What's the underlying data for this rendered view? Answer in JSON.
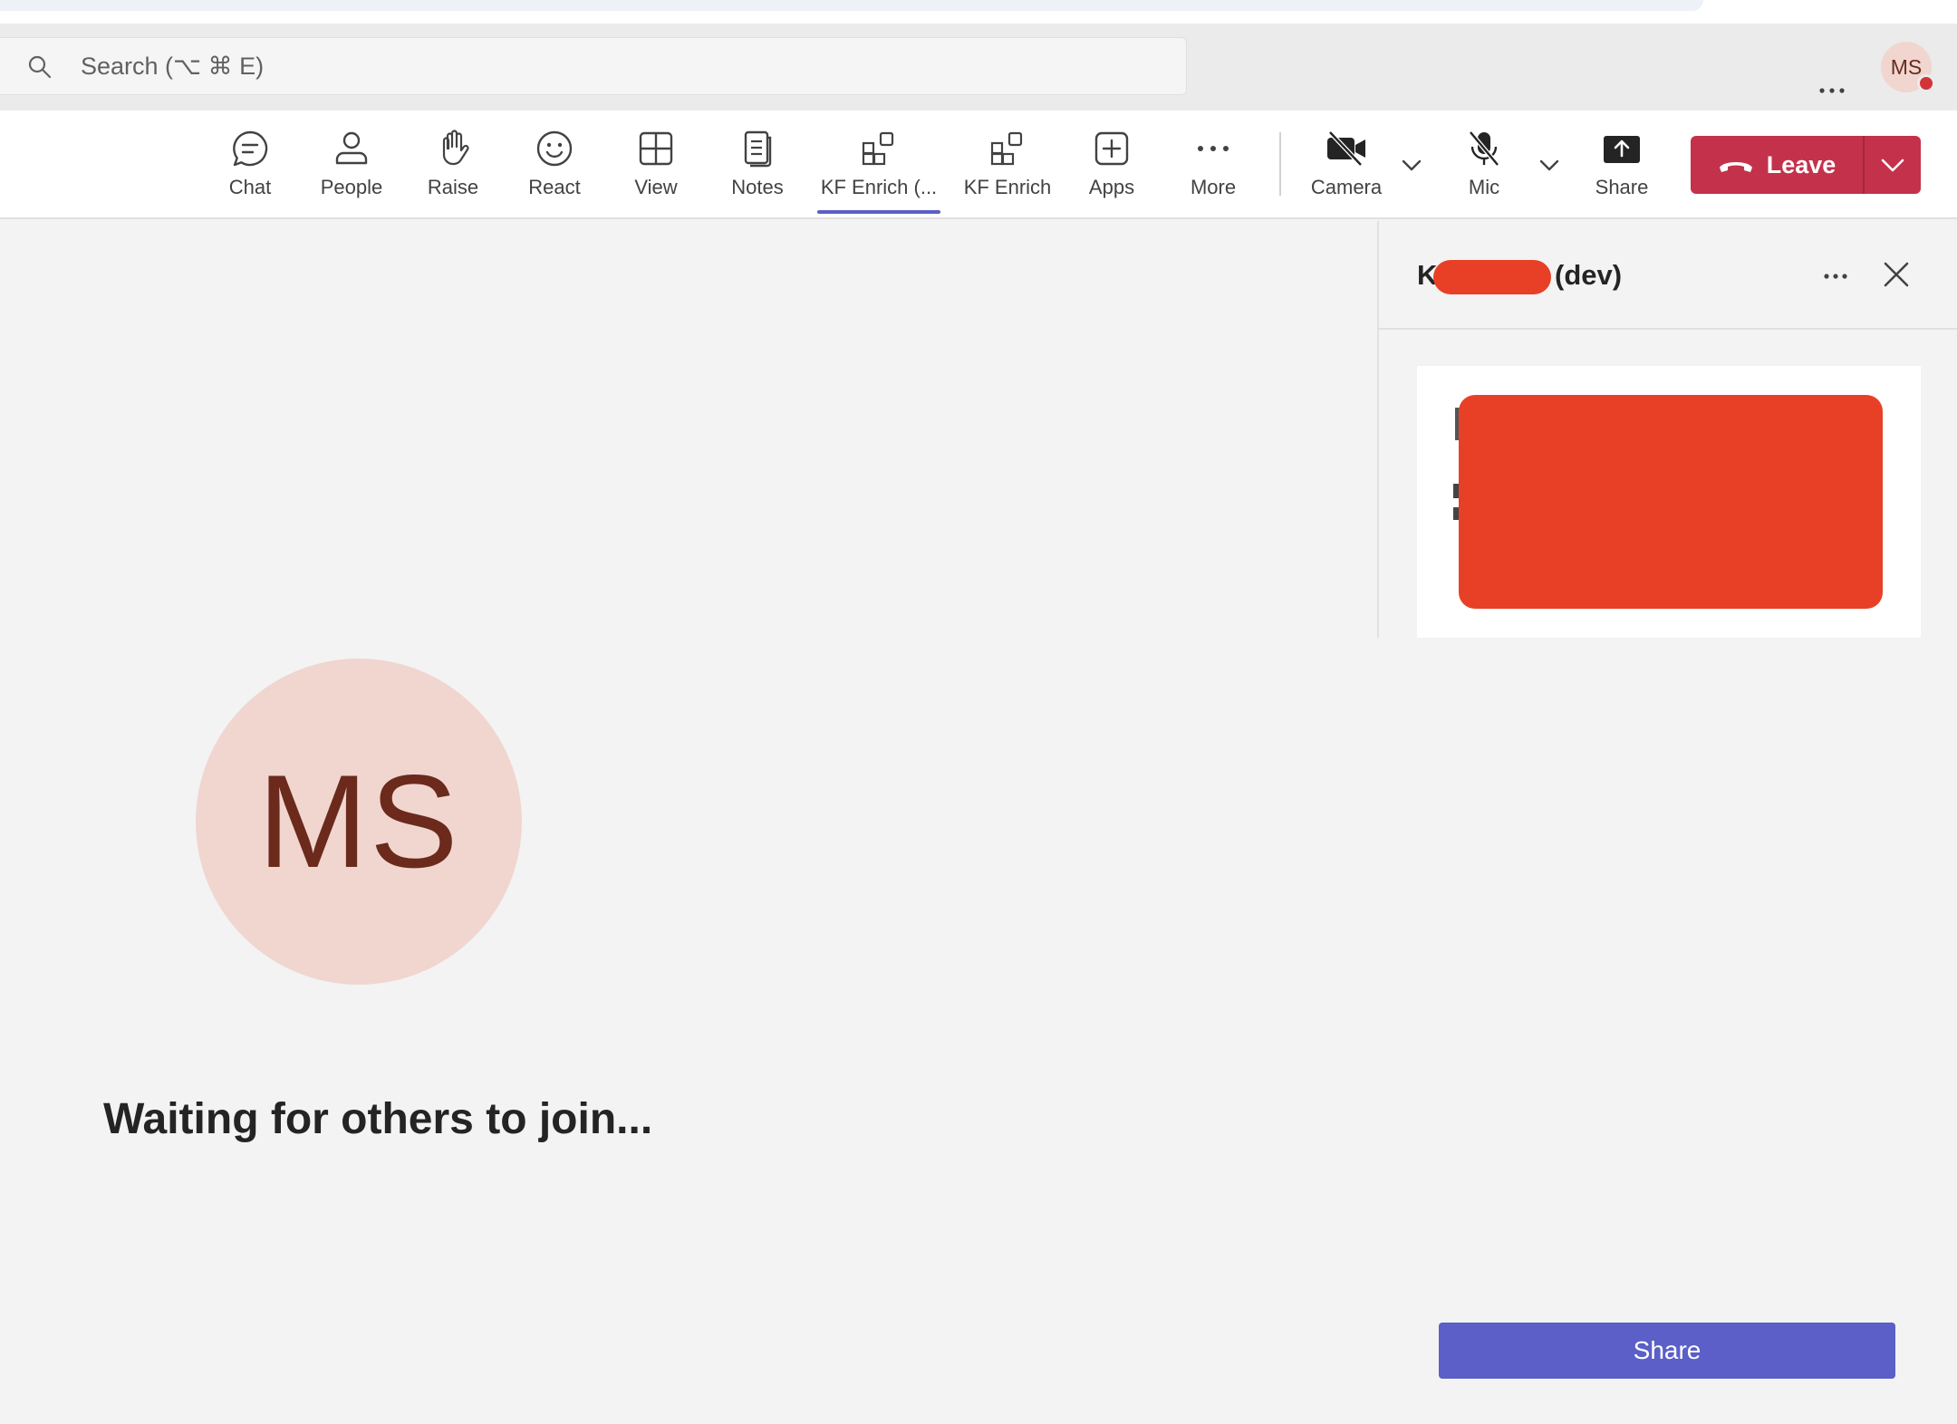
{
  "search": {
    "placeholder": "Search (⌥ ⌘ E)"
  },
  "profile": {
    "initials": "MS",
    "presence": "busy"
  },
  "toolbar": {
    "items": [
      {
        "label": "Chat",
        "icon": "chat-icon"
      },
      {
        "label": "People",
        "icon": "people-icon"
      },
      {
        "label": "Raise",
        "icon": "hand-icon"
      },
      {
        "label": "React",
        "icon": "smile-icon"
      },
      {
        "label": "View",
        "icon": "grid-icon"
      },
      {
        "label": "Notes",
        "icon": "notes-icon"
      },
      {
        "label": "KF Enrich (...",
        "icon": "apps-add-icon",
        "active": true
      },
      {
        "label": "KF Enrich",
        "icon": "apps-add-icon"
      },
      {
        "label": "Apps",
        "icon": "plus-square-icon"
      },
      {
        "label": "More",
        "icon": "more-icon"
      }
    ],
    "camera_label": "Camera",
    "mic_label": "Mic",
    "share_label": "Share",
    "leave_label": "Leave"
  },
  "side_panel": {
    "title_prefix": "K",
    "title_suffix": "(dev)"
  },
  "main": {
    "avatar_initials": "MS",
    "waiting_text": "Waiting for others to join..."
  },
  "panel_share_button": "Share",
  "colors": {
    "accent": "#5b5fc7",
    "leave": "#c4314b",
    "avatar_bg": "#f0d6cf",
    "avatar_text": "#6b2a1c",
    "redaction": "#e84027"
  }
}
